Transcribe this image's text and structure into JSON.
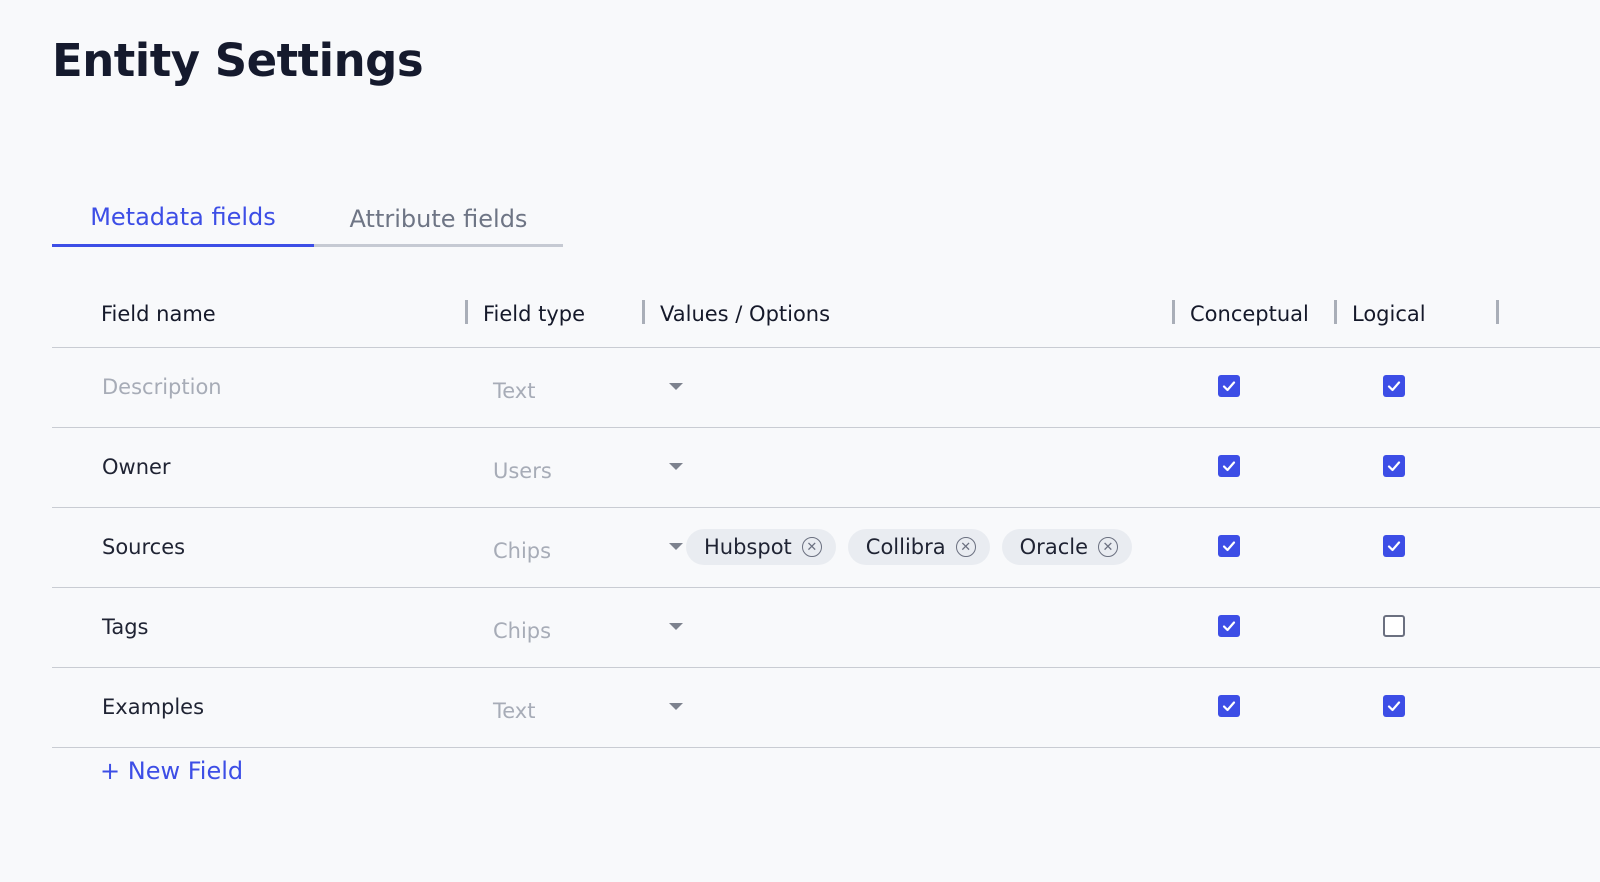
{
  "page": {
    "title": "Entity Settings"
  },
  "tabs": [
    {
      "label": "Metadata fields",
      "active": true
    },
    {
      "label": "Attribute fields",
      "active": false
    }
  ],
  "table": {
    "columns": [
      "Field name",
      "Field type",
      "Values / Options",
      "Conceptual",
      "Logical"
    ],
    "rows": [
      {
        "name": "Description",
        "name_is_placeholder": true,
        "type": "Text",
        "chips": [],
        "conceptual": true,
        "logical": true
      },
      {
        "name": "Owner",
        "name_is_placeholder": false,
        "type": "Users",
        "chips": [],
        "conceptual": true,
        "logical": true
      },
      {
        "name": "Sources",
        "name_is_placeholder": false,
        "type": "Chips",
        "chips": [
          "Hubspot",
          "Collibra",
          "Oracle"
        ],
        "conceptual": true,
        "logical": true
      },
      {
        "name": "Tags",
        "name_is_placeholder": false,
        "type": "Chips",
        "chips": [],
        "conceptual": true,
        "logical": false
      },
      {
        "name": "Examples",
        "name_is_placeholder": false,
        "type": "Text",
        "chips": [],
        "conceptual": true,
        "logical": true
      }
    ]
  },
  "actions": {
    "new_field_label": "+ New Field"
  },
  "colors": {
    "accent": "#3d4ee6",
    "background": "#f8f9fb",
    "title": "#151a2d"
  },
  "icons": {
    "dropdown": "caret-down-icon",
    "chip_remove": "close-circle-icon",
    "checkbox": "checkmark-icon"
  }
}
